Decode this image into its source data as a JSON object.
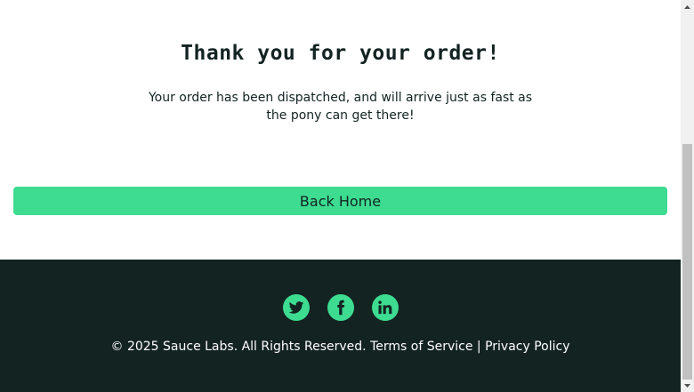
{
  "complete": {
    "header": "Thank you for your order!",
    "text": "Your order has been dispatched, and will arrive just as fast as the pony can get there!",
    "back_home_label": "Back Home"
  },
  "footer": {
    "social": [
      {
        "icon": "twitter-icon"
      },
      {
        "icon": "facebook-icon"
      },
      {
        "icon": "linkedin-icon"
      }
    ],
    "copy_text": "© 2025 Sauce Labs. All Rights Reserved.",
    "terms_label": "Terms of Service",
    "separator": "|",
    "privacy_label": "Privacy Policy"
  },
  "colors": {
    "accent": "#3ddc91",
    "dark": "#132322",
    "background": "#ffffff"
  }
}
